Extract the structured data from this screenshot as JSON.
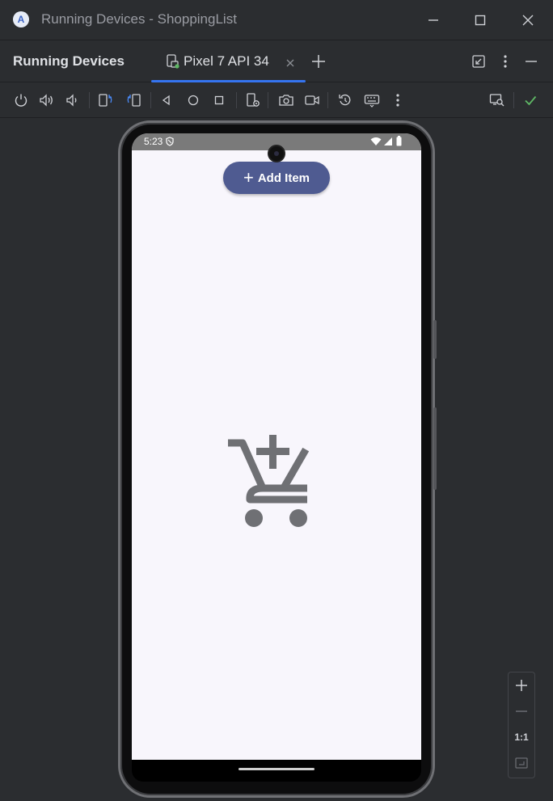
{
  "window": {
    "title": "Running Devices - ShoppingList",
    "logo_letter": "A"
  },
  "panel": {
    "title": "Running Devices",
    "device_tab": {
      "label": "Pixel 7 API 34",
      "active_indicator_color": "#3574f0"
    }
  },
  "toolbar": {
    "icons": [
      "power-icon",
      "volume-up-icon",
      "volume-down-icon",
      "rotate-left-icon",
      "rotate-right-icon",
      "back-icon",
      "home-icon",
      "overview-icon",
      "device-settings-icon",
      "screenshot-icon",
      "screen-record-icon",
      "reset-icon",
      "keyboard-icon",
      "more-icon",
      "layout-inspector-icon",
      "checkmark-icon"
    ]
  },
  "device": {
    "status_time": "5:23",
    "add_button_label": "Add Item",
    "add_button_color": "#4f5b91",
    "empty_state_icon": "add-shopping-cart-icon",
    "screen_background": "#f8f6fc"
  },
  "zoom": {
    "one_to_one_label": "1:1"
  },
  "colors": {
    "ide_background": "#2b2d30",
    "accent": "#3574f0",
    "success": "#5fb865"
  }
}
